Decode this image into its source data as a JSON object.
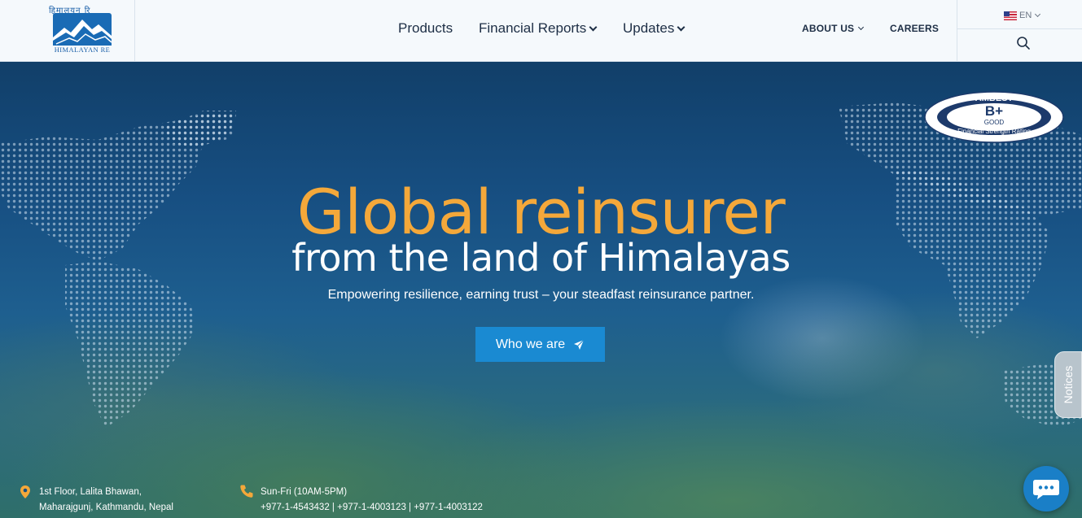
{
  "brand": {
    "logo_devanagari": "हिमालयन रि",
    "logo_text": "HIMALAYAN RE",
    "primary_color": "#1a8ad2",
    "accent_color": "#f4a83a"
  },
  "nav": {
    "main": [
      {
        "label": "Products",
        "has_dropdown": false
      },
      {
        "label": "Financial Reports",
        "has_dropdown": true
      },
      {
        "label": "Updates",
        "has_dropdown": true
      }
    ],
    "about_label": "ABOUT US",
    "careers_label": "CAREERS",
    "language": "EN",
    "search_icon": "search-icon"
  },
  "hero": {
    "title_line1": "Global reinsurer",
    "title_line2": "from the land of Himalayas",
    "subtitle": "Empowering resilience, earning trust – your steadfast reinsurance partner.",
    "cta_label": "Who we are",
    "cta_icon": "paper-plane-icon"
  },
  "rating_badge": {
    "agency": "AMBEST",
    "grade": "B+",
    "label": "GOOD",
    "caption": "Financial Strength Rating"
  },
  "notices_tab": "Notices",
  "contact": {
    "address_line1": "1st Floor, Lalita Bhawan,",
    "address_line2": "Maharajgunj, Kathmandu, Nepal",
    "hours": "Sun-Fri (10AM-5PM)",
    "phones": "+977-1-4543432  |  +977-1-4003123  |  +977-1-4003122"
  },
  "chat_icon": "chat-bubble-icon"
}
